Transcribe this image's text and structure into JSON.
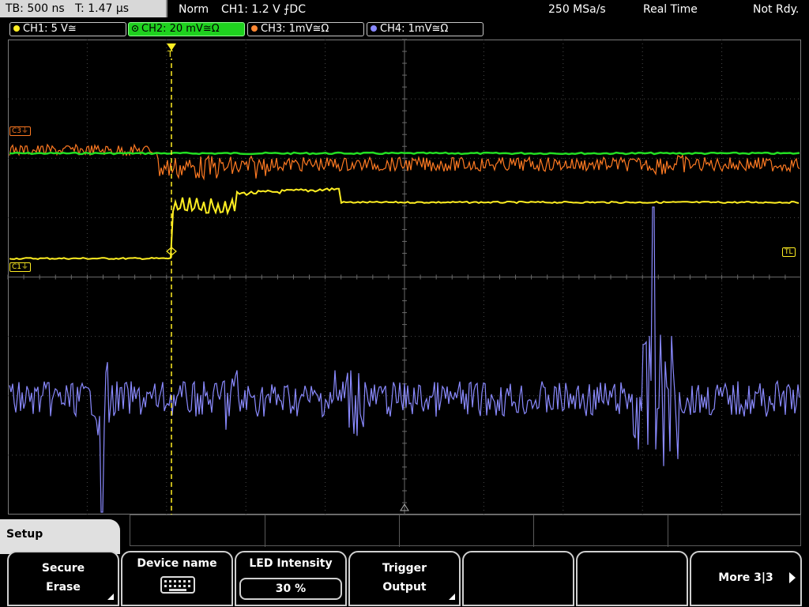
{
  "status": {
    "timebase": "TB: 500 ns",
    "time_pos": "T: 1.47 µs",
    "trigger_mode": "Norm",
    "trigger_info": "CH1: 1.2 V ⨍DC",
    "sample_rate": "250 MSa/s",
    "acq_mode": "Real Time",
    "state": "Not Rdy."
  },
  "channels": [
    {
      "label": "CH1: 5 V≅",
      "color": "#ffee22",
      "active": false
    },
    {
      "label": "CH2: 20 mV≅Ω",
      "color": "#22ff22",
      "active": true
    },
    {
      "label": "CH3: 1mV≅Ω",
      "color": "#ff8833",
      "active": false
    },
    {
      "label": "CH4: 1mV≅Ω",
      "color": "#8888ff",
      "active": false
    }
  ],
  "markers": {
    "c3": "C3⏚",
    "c1": "C1⏚",
    "tl": "TL",
    "trigger": "T"
  },
  "menu": {
    "title": "Setup",
    "softkeys": {
      "secure_erase": {
        "line1": "Secure",
        "line2": "Erase"
      },
      "device_name": {
        "line1": "Device name",
        "icon": "keyboard-icon"
      },
      "led_intensity": {
        "line1": "LED Intensity",
        "value": "30 %"
      },
      "trigger_output": {
        "line1": "Trigger",
        "line2": "Output"
      },
      "more": {
        "line1": "More 3|3"
      }
    }
  },
  "colors": {
    "ch1": "#ffee22",
    "ch2": "#22dd22",
    "ch3": "#ff7a22",
    "ch4": "#8a8aff",
    "grid": "#5c5c5c"
  }
}
